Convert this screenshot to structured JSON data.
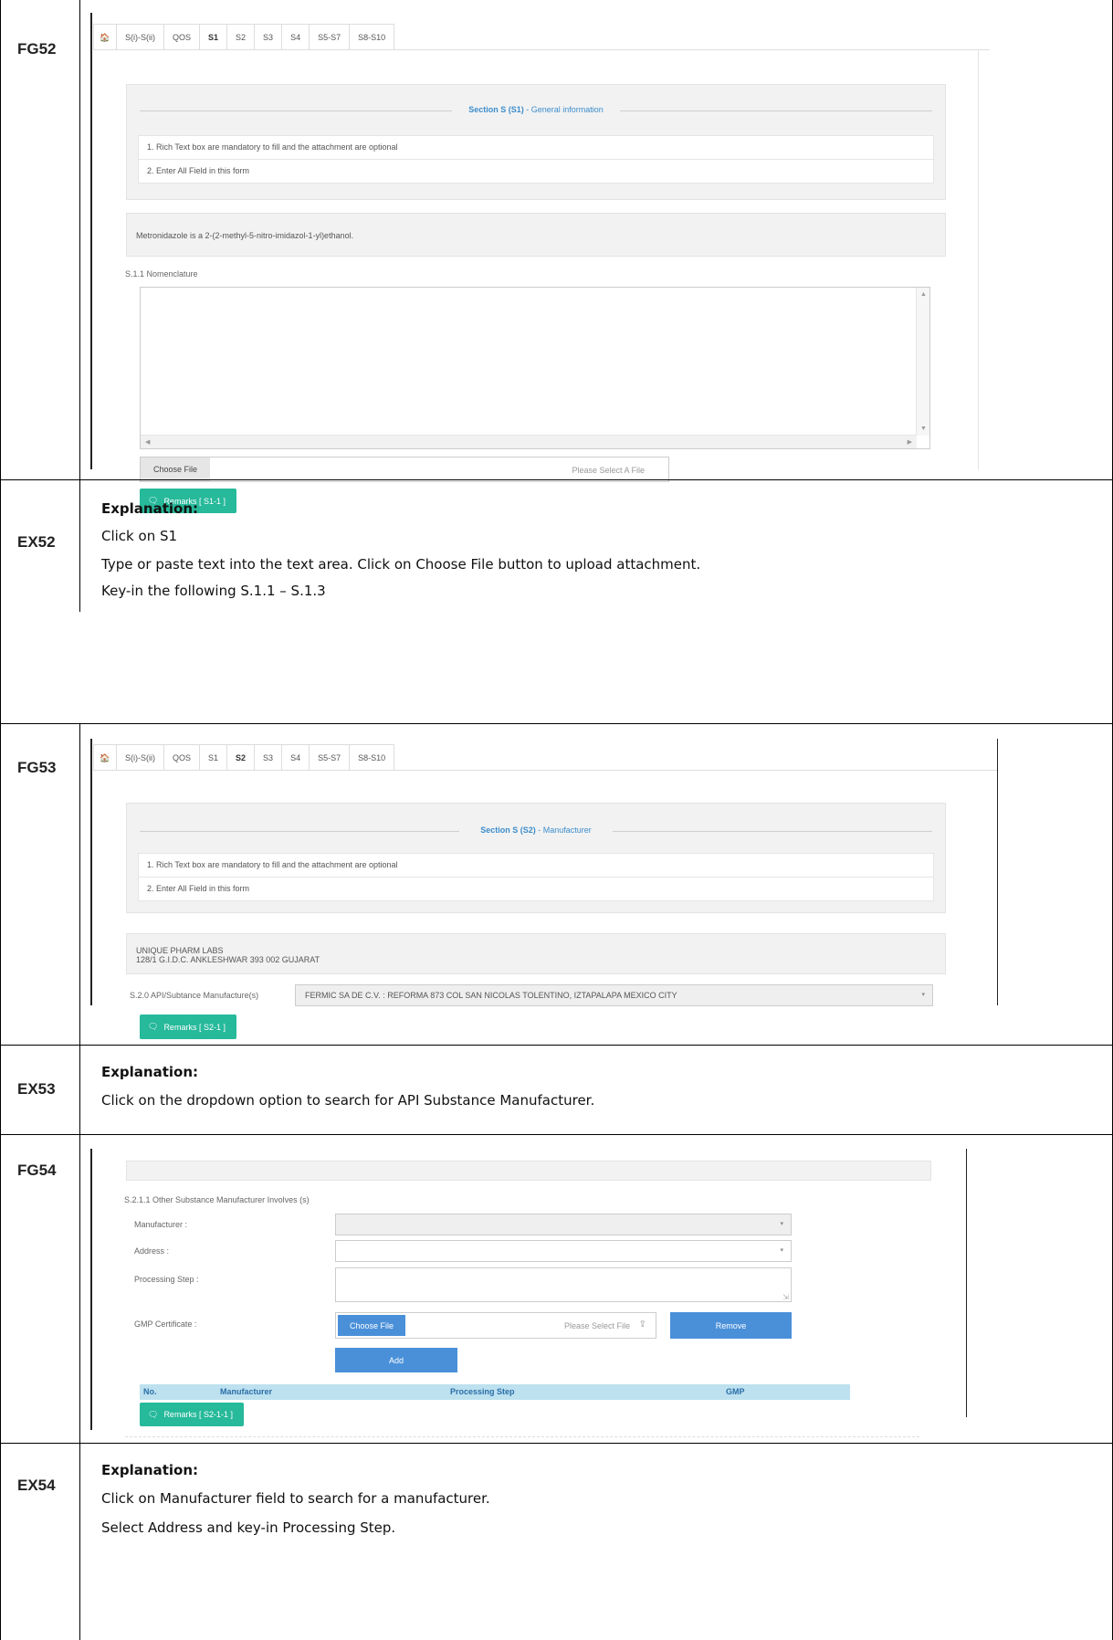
{
  "rows": {
    "fg52": {
      "label": "FG52"
    },
    "ex52": {
      "label": "EX52",
      "heading": "Explanation:",
      "lines": [
        "Click on S1",
        "Type or paste text into the text area. Click on Choose File button to upload attachment.",
        "Key-in the following S.1.1 – S.1.3"
      ]
    },
    "fg53": {
      "label": "FG53"
    },
    "ex53": {
      "label": "EX53",
      "heading": "Explanation:",
      "lines": [
        "Click on the dropdown option to search for API Substance Manufacturer."
      ]
    },
    "fg54": {
      "label": "FG54"
    },
    "ex54": {
      "label": "EX54",
      "heading": "Explanation:",
      "lines": [
        "Click on Manufacturer field to search for a manufacturer.",
        "Select Address and key-in Processing Step."
      ]
    }
  },
  "tabs": {
    "home_icon": "home-icon",
    "items": [
      "S(i)-S(ii)",
      "QOS",
      "S1",
      "S2",
      "S3",
      "S4",
      "S5-S7",
      "S8-S10"
    ]
  },
  "s1": {
    "section_prefix": "Section S (S1)",
    "section_suffix": " - General information",
    "notes": [
      "1. Rich Text box are mandatory to fill and the attachment are optional",
      "2. Enter All Field in this form"
    ],
    "info": "Metronidazole is a 2-(2-methyl-5-nitro-imidazol-1-yl)ethanol.",
    "field_label": "S.1.1 Nomenclature",
    "choose_file": "Choose File",
    "file_placeholder": "Please Select A File",
    "remarks": "Remarks [ S1-1 ]"
  },
  "s2": {
    "section_prefix": "Section S (S2)",
    "section_suffix": " - Manufacturer",
    "notes": [
      "1. Rich Text box are mandatory to fill and the attachment are optional",
      "2. Enter All Field in this form"
    ],
    "info_line1": "UNIQUE PHARM LABS",
    "info_line2": "128/1 G.I.D.C. ANKLESHWAR 393 002 GUJARAT",
    "field_label": "S.2.0 API/Subtance Manufacture(s)",
    "selected": "FERMIC SA DE C.V. : REFORMA 873 COL SAN NICOLAS TOLENTINO, IZTAPALAPA MEXICO CITY",
    "remarks": "Remarks [ S2-1 ]"
  },
  "s21": {
    "title": "S.2.1.1 Other Substance Manufacturer Involves (s)",
    "manufacturer_label": "Manufacturer :",
    "address_label": "Address :",
    "processing_label": "Processing Step :",
    "gmp_label": "GMP Certificate :",
    "choose_file": "Choose File",
    "file_placeholder": "Please Select File",
    "remove": "Remove",
    "add": "Add",
    "columns": [
      "No.",
      "Manufacturer",
      "Processing Step",
      "GMP"
    ],
    "remarks": "Remarks [ S2-1-1 ]"
  }
}
